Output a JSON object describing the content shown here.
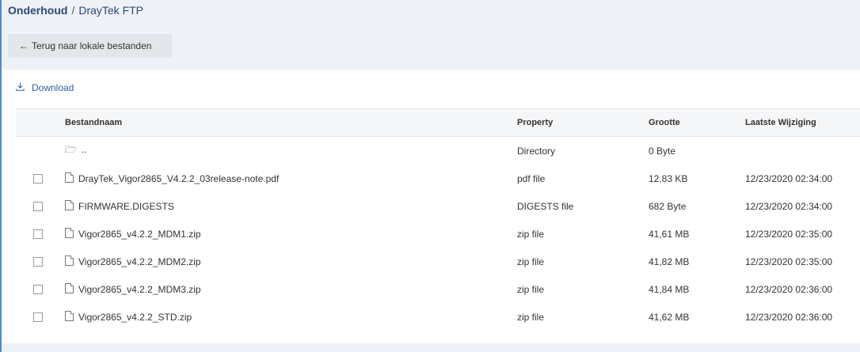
{
  "breadcrumb": {
    "root": "Onderhoud",
    "separator": "/",
    "current": "DrayTek FTP"
  },
  "back_button": {
    "arrow": "←",
    "label": "Terug naar lokale bestanden"
  },
  "toolbar": {
    "download_icon": "download-icon",
    "download_label": "Download"
  },
  "table": {
    "headers": {
      "name": "Bestandnaam",
      "property": "Property",
      "size": "Grootte",
      "modified": "Laatste Wijziging"
    },
    "parent_row": {
      "name": "..",
      "property": "Directory",
      "size": "0 Byte",
      "modified": ""
    },
    "rows": [
      {
        "name": "DrayTek_Vigor2865_V4.2.2_03release-note.pdf",
        "property": "pdf file",
        "size": "12,83 KB",
        "modified": "12/23/2020 02:34:00"
      },
      {
        "name": "FIRMWARE.DIGESTS",
        "property": "DIGESTS file",
        "size": "682 Byte",
        "modified": "12/23/2020 02:34:00"
      },
      {
        "name": "Vigor2865_v4.2.2_MDM1.zip",
        "property": "zip file",
        "size": "41,61 MB",
        "modified": "12/23/2020 02:35:00"
      },
      {
        "name": "Vigor2865_v4.2.2_MDM2.zip",
        "property": "zip file",
        "size": "41,82 MB",
        "modified": "12/23/2020 02:35:00"
      },
      {
        "name": "Vigor2865_v4.2.2_MDM3.zip",
        "property": "zip file",
        "size": "41,84 MB",
        "modified": "12/23/2020 02:36:00"
      },
      {
        "name": "Vigor2865_v4.2.2_STD.zip",
        "property": "zip file",
        "size": "41,62 MB",
        "modified": "12/23/2020 02:36:00"
      }
    ]
  },
  "colors": {
    "accent": "#2d5f9e",
    "frame": "#5b86c5",
    "header_bg": "#eef1f5"
  }
}
